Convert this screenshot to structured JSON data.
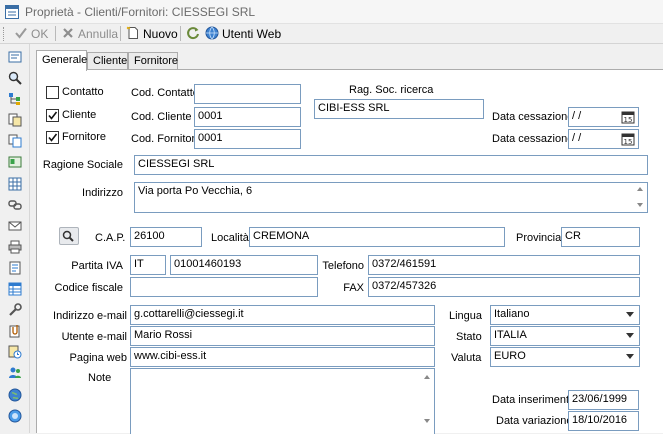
{
  "window": {
    "title": "Proprietà - Clienti/Fornitori: CIESSEGI SRL"
  },
  "toolbar": {
    "ok_label": "OK",
    "annulla_label": "Annulla",
    "nuovo_label": "Nuovo",
    "utenti_web_label": "Utenti Web"
  },
  "tabs": {
    "generale": "Generale",
    "cliente": "Cliente",
    "fornitore": "Fornitore"
  },
  "contatto": {
    "label": "Contatto",
    "checked": false,
    "cod_label": "Cod. Contatto",
    "cod_value": ""
  },
  "cliente": {
    "label": "Cliente",
    "checked": true,
    "cod_label": "Cod. Cliente",
    "cod_value": "0001"
  },
  "fornitore": {
    "label": "Fornitore",
    "checked": true,
    "cod_label": "Cod. Fornitore",
    "cod_value": "0001"
  },
  "rag_soc_ricerca": {
    "label": "Rag. Soc. ricerca",
    "value": "CIBI-ESS SRL"
  },
  "data_cessazione_1": {
    "label": "Data cessazione",
    "value": " / /"
  },
  "data_cessazione_2": {
    "label": "Data cessazione",
    "value": " / /"
  },
  "ragione_sociale": {
    "label": "Ragione Sociale",
    "value": "CIESSEGI SRL"
  },
  "indirizzo": {
    "label": "Indirizzo",
    "value": "Via porta Po Vecchia, 6"
  },
  "cap": {
    "label": "C.A.P.",
    "value": "26100"
  },
  "localita": {
    "label": "Località",
    "value": "CREMONA"
  },
  "provincia": {
    "label": "Provincia",
    "value": "CR"
  },
  "partita_iva": {
    "label": "Partita IVA",
    "country": "IT",
    "value": "01001460193"
  },
  "telefono": {
    "label": "Telefono",
    "value": "0372/461591"
  },
  "codice_fiscale": {
    "label": "Codice fiscale",
    "value": ""
  },
  "fax": {
    "label": "FAX",
    "value": "0372/457326"
  },
  "email": {
    "label": "Indirizzo e-mail",
    "value": "g.cottarelli@ciessegi.it"
  },
  "utente_email": {
    "label": "Utente e-mail",
    "value": "Mario Rossi"
  },
  "pagina_web": {
    "label": "Pagina web",
    "value": "www.cibi-ess.it"
  },
  "note": {
    "label": "Note",
    "value": ""
  },
  "lingua": {
    "label": "Lingua",
    "value": "Italiano"
  },
  "stato": {
    "label": "Stato",
    "value": "ITALIA"
  },
  "valuta": {
    "label": "Valuta",
    "value": "EURO"
  },
  "data_inserimento": {
    "label": "Data inserimento",
    "value": "23/06/1999"
  },
  "data_variazione": {
    "label": "Data variazione",
    "value": "18/10/2016"
  },
  "colors": {
    "field_border": "#7a9cbf",
    "panel_bg": "#ffffff",
    "chrome_bg": "#f0f0f0"
  }
}
